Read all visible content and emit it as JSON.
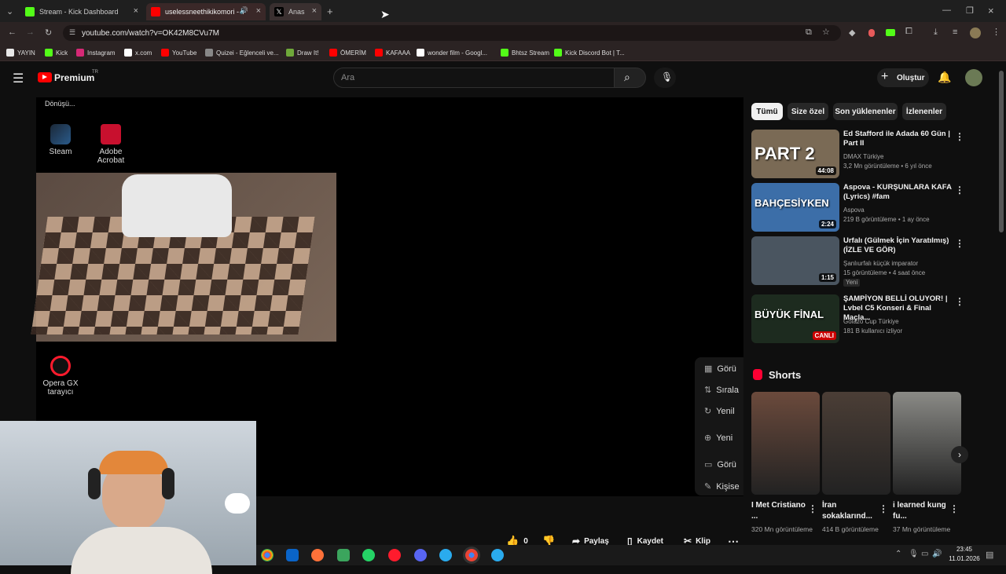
{
  "browser": {
    "tabs": [
      {
        "label": "Stream - Kick Dashboard",
        "fav_color": "#53fc18"
      },
      {
        "label": "uselessneethikikomori - Yo",
        "fav_color": "#ff0000"
      },
      {
        "label": "Anas",
        "fav_color": "#000000"
      }
    ],
    "url": "youtube.com/watch?v=OK42M8CVu7M",
    "bookmarks": [
      {
        "label": "YAYIN",
        "icon": "folder-icon",
        "color": "#e8e8e8"
      },
      {
        "label": "Kick",
        "icon": "kick-icon",
        "color": "#53fc18"
      },
      {
        "label": "Instagram",
        "icon": "instagram-icon",
        "color": "#d62976"
      },
      {
        "label": "x.com",
        "icon": "x-icon",
        "color": "#ffffff"
      },
      {
        "label": "YouTube",
        "icon": "youtube-icon",
        "color": "#ff0000"
      },
      {
        "label": "Quizei - Eğlenceli ve...",
        "icon": "quizei-icon",
        "color": "#888888"
      },
      {
        "label": "Draw It!",
        "icon": "draw-icon",
        "color": "#6fa83a"
      },
      {
        "label": "ÖMERİM",
        "icon": "youtube-icon",
        "color": "#ff0000"
      },
      {
        "label": "KAFAAA",
        "icon": "youtube-icon",
        "color": "#ff0000"
      },
      {
        "label": "wonder film - Googl...",
        "icon": "google-icon",
        "color": "#ffffff"
      },
      {
        "label": "Bhtsz Stream",
        "icon": "kick-icon",
        "color": "#53fc18"
      },
      {
        "label": "Kick Discord Bot | T...",
        "icon": "kick-icon",
        "color": "#53fc18"
      }
    ]
  },
  "youtube": {
    "logo_text": "Premium",
    "logo_region": "TR",
    "search_placeholder": "Ara",
    "create_label": "Oluştur",
    "chips": [
      "Tümü",
      "Size özel",
      "Son yüklenenler",
      "İzlenenler"
    ],
    "recommendations": [
      {
        "title": "Ed Stafford ile Adada 60 Gün | Part II",
        "channel": "DMAX Türkiye",
        "verified": true,
        "stats": "3,2 Mn görüntüleme • 6 yıl önce",
        "duration": "44:08",
        "thumb_text": "PART 2",
        "thumb_color": "#7a6a55"
      },
      {
        "title": "Aspova - KURŞUNLARA KAFA (Lyrics) #fam",
        "channel": "Aspova",
        "verified": true,
        "stats": "219 B görüntüleme • 1 ay önce",
        "duration": "2:24",
        "thumb_text": "BAHÇESİYKEN",
        "thumb_color": "#3c6ea8"
      },
      {
        "title": "Urfalı  (Gülmek İçin Yaratılmış) (İZLE VE GÖR)",
        "channel": "Şanlıurfalı küçük imparator",
        "verified": false,
        "stats": "15 görüntüleme • 4 saat önce",
        "badge": "Yeni",
        "duration": "1:15",
        "thumb_text": "",
        "thumb_color": "#4a5560"
      },
      {
        "title": "ŞAMPİYON BELLİ OLUYOR! | Lvbel C5 Konseri & Final Maçla...",
        "channel": "Golazo Cup Türkiye",
        "verified": false,
        "stats": "181 B kullanıcı izliyor",
        "duration": "CANLI",
        "thumb_text": "BÜYÜK FİNAL",
        "thumb_color": "#1d2b1f"
      }
    ],
    "shorts_heading": "Shorts",
    "shorts": [
      {
        "title": "I Met Cristiano ...",
        "views": "320 Mn görüntüleme",
        "color": "#6b4a3c"
      },
      {
        "title": "İran sokaklarınd...",
        "views": "414 B görüntüleme",
        "color": "#4b3e36"
      },
      {
        "title": "i learned kung fu...",
        "views": "37 Mn görüntüleme",
        "color": "#8a8a86"
      }
    ],
    "actions": {
      "likes": "0",
      "share": "Paylaş",
      "save": "Kaydet",
      "clip": "Klip"
    }
  },
  "desktop": {
    "top_text": "Dönüşü...",
    "icons": [
      {
        "label": "Steam"
      },
      {
        "label": "Adobe Acrobat"
      },
      {
        "label": "Opera GX tarayıcı"
      }
    ],
    "overlay_menu": [
      "Görü",
      "Sırala",
      "Yenil",
      "Yeni",
      "Görü",
      "Kişise"
    ]
  },
  "system": {
    "time": "23:45",
    "date": "11.01.2026"
  }
}
